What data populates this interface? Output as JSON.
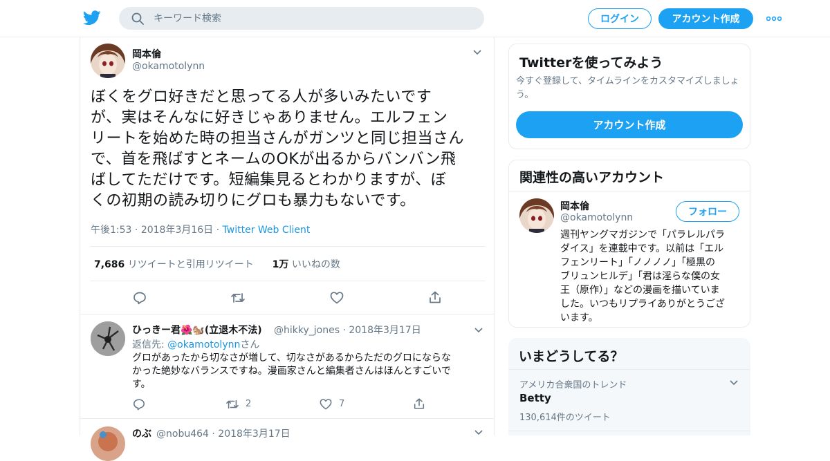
{
  "header": {
    "search_placeholder": "キーワード検索",
    "login_label": "ログイン",
    "signup_label": "アカウント作成"
  },
  "tweet": {
    "author_name": "岡本倫",
    "author_handle": "@okamotolynn",
    "text_lines": [
      "ぼくをグロ好きだと思ってる人が多いみたいです",
      "が、実はそんなに好きじゃありません。エルフェン",
      "リートを始めた時の担当さんがガンツと同じ担当さん",
      "で、首を飛ばすとネームのOKが出るからバンバン飛",
      "ばしてただけです。短編集見るとわかりますが、ぼ",
      "くの初期の読み切りにグロも暴力もないです。"
    ],
    "time": "午後1:53",
    "date": "2018年3月16日",
    "client": "Twitter Web Client",
    "retweet_count": "7,686",
    "retweet_label": "リツイートと引用リツイート",
    "like_count": "1万",
    "like_label": "いいねの数"
  },
  "replies": [
    {
      "name": "ひっきー君🌺🐿️(立退木不法)",
      "handle": "@hikky_jones",
      "date": "2018年3月17日",
      "reply_to_prefix": "返信先: ",
      "reply_to_handle": "@okamotolynn",
      "reply_to_suffix": "さん",
      "text_lines": [
        "グロがあったから切なさが増して、切なさがあるからただのグロにならな",
        "かった絶妙なバランスですね。漫画家さんと編集者さんはほんとすごいで",
        "す。"
      ],
      "retweets": "2",
      "likes": "7"
    },
    {
      "name": "のぶ",
      "handle": "@nobu464",
      "date": "2018年3月17日"
    }
  ],
  "signup_card": {
    "title": "Twitterを使ってみよう",
    "subtitle_lines": [
      "今すぐ登録して、タイムラインをカスタマイズしましょ",
      "う。"
    ],
    "button_label": "アカウント作成"
  },
  "related_card": {
    "title": "関連性の高いアカウント",
    "name": "岡本倫",
    "handle": "@okamotolynn",
    "follow_label": "フォロー",
    "bio_lines": [
      "週刊ヤングマガジンで「パラレルパラ",
      "ダイス」を連載中です。以前は「エル",
      "フェンリート」「ノノノノ」「極黒の",
      "ブリュンヒルデ」「君は淫らな僕の女",
      "王（原作）」などの漫画を描いていま",
      "した。いつもリプライありがとうござ",
      "います。"
    ]
  },
  "trends_card": {
    "title": "いまどうしてる？",
    "trend_context": "アメリカ合衆国のトレンド",
    "trend_name": "Betty",
    "trend_count": "130,614件のツイート"
  },
  "colors": {
    "accent": "#1da1f2",
    "link": "#1b95e0",
    "muted": "#657786",
    "border": "#e6ecf0"
  }
}
